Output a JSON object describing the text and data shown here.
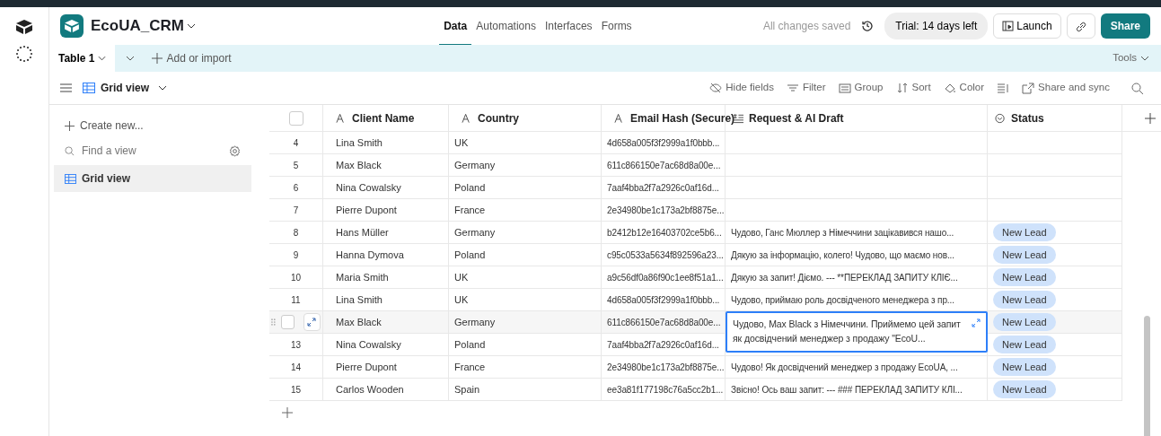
{
  "base": {
    "name": "EcoUA_CRM"
  },
  "nav_tabs": [
    {
      "label": "Data",
      "selected": true
    },
    {
      "label": "Automations",
      "selected": false
    },
    {
      "label": "Interfaces",
      "selected": false
    },
    {
      "label": "Forms",
      "selected": false
    }
  ],
  "save_status": "All changes saved",
  "trial": "Trial: 14 days left",
  "launch": "Launch",
  "share": "Share",
  "table_tabs": [
    {
      "label": "Table 1",
      "selected": true
    }
  ],
  "add_import": "Add or import",
  "tools": "Tools",
  "view": {
    "name": "Grid view"
  },
  "toolbar": [
    {
      "kind": "hide",
      "label": "Hide fields"
    },
    {
      "kind": "filter",
      "label": "Filter"
    },
    {
      "kind": "group",
      "label": "Group"
    },
    {
      "kind": "sort",
      "label": "Sort"
    },
    {
      "kind": "color",
      "label": "Color"
    },
    {
      "kind": "height"
    },
    {
      "kind": "share",
      "label": "Share and sync"
    },
    {
      "kind": "search"
    }
  ],
  "sidebar": {
    "create": "Create new...",
    "find_placeholder": "Find a view",
    "items": [
      {
        "label": "Grid view",
        "selected": true
      }
    ]
  },
  "table": {
    "all_selected": false,
    "columns": [
      {
        "kind": "text",
        "label": "Client Name"
      },
      {
        "kind": "text",
        "label": "Country"
      },
      {
        "kind": "text",
        "label": "Email Hash (Secure)"
      },
      {
        "kind": "longtext",
        "label": "Request & AI Draft"
      },
      {
        "kind": "select",
        "label": "Status"
      }
    ],
    "rows": [
      {
        "number": "4",
        "client": "Lina Smith",
        "country": "UK",
        "email": "4d658a005f3f2999a1f0bbb...",
        "hovered": false
      },
      {
        "number": "5",
        "client": "Max Black",
        "country": "Germany",
        "email": "611c866150e7ac68d8a00e...",
        "hovered": false
      },
      {
        "number": "6",
        "client": "Nina Cowalsky",
        "country": "Poland",
        "email": "7aaf4bba2f7a2926c0af16d...",
        "hovered": false
      },
      {
        "number": "7",
        "client": "Pierre Dupont",
        "country": "France",
        "email": "2e34980be1c173a2bf8875e...",
        "hovered": false
      },
      {
        "number": "8",
        "client": "Hans Müller",
        "country": "Germany",
        "email": "b2412b12e16403702ce5b6...",
        "request": "Чудово, Ганс Мюллер з Німеччини зацікавився нашо...",
        "status": "New Lead",
        "hovered": false
      },
      {
        "number": "9",
        "client": "Hanna Dymova",
        "country": "Poland",
        "email": "c95c0533a5634f892596a23...",
        "request": "Дякую за інформацію, колего! Чудово, що маємо нов...",
        "status": "New Lead",
        "hovered": false
      },
      {
        "number": "10",
        "client": "Maria Smith",
        "country": "UK",
        "email": "a9c56df0a86f90c1ee8f51a1...",
        "request": "Дякую за запит! Діємо. --- **ПЕРЕКЛАД ЗАПИТУ КЛІЄ...",
        "status": "New Lead",
        "hovered": false
      },
      {
        "number": "11",
        "client": "Lina Smith",
        "country": "UK",
        "email": "4d658a005f3f2999a1f0bbb...",
        "request": "Чудово, приймаю роль досвідченого менеджера з пр...",
        "status": "New Lead",
        "hovered": false
      },
      {
        "client": "Max Black",
        "country": "Germany",
        "email": "611c866150e7ac68d8a00e...",
        "request": "Чудово, Max Black з Німеччини. Приймемо цей запит як досвідчений менеджер з продажу \"EcoU...",
        "status": "New Lead",
        "hovered": true,
        "expanded": true
      },
      {
        "number": "13",
        "client": "Nina Cowalsky",
        "country": "Poland",
        "email": "7aaf4bba2f7a2926c0af16d...",
        "status": "New Lead",
        "hovered": false
      },
      {
        "number": "14",
        "client": "Pierre Dupont",
        "country": "France",
        "email": "2e34980be1c173a2bf8875e...",
        "request": "Чудово! Як досвідчений менеджер з продажу EcoUA, ...",
        "status": "New Lead",
        "hovered": false
      },
      {
        "number": "15",
        "client": "Carlos Wooden",
        "country": "Spain",
        "email": "ee3a81f177198c76a5cc2b1...",
        "request": "Звісно! Ось ваш запит: --- ### ПЕРЕКЛАД ЗАПИТУ КЛІ...",
        "status": "New Lead",
        "hovered": false
      }
    ]
  }
}
